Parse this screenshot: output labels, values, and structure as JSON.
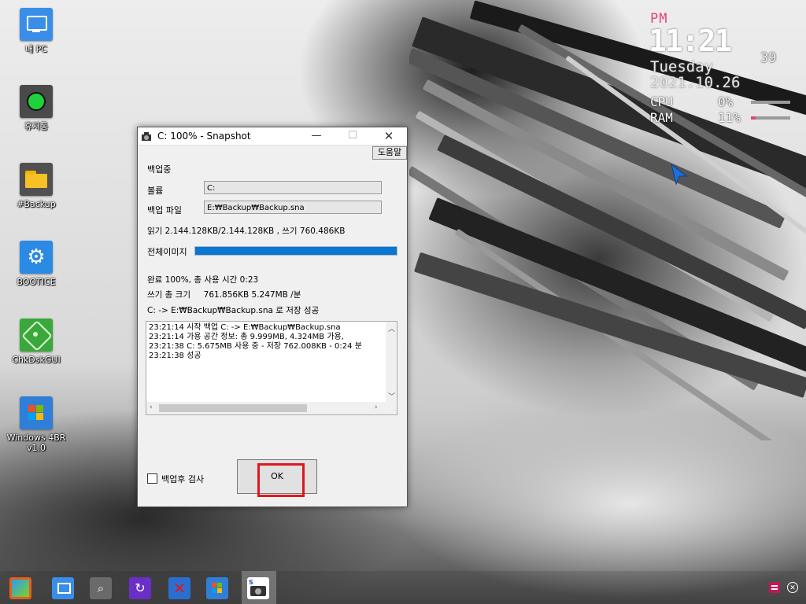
{
  "desktop": {
    "icons": [
      {
        "label": "내 PC",
        "icon": "monitor-icon"
      },
      {
        "label": "휴지통",
        "icon": "recycle-bin-icon"
      },
      {
        "label": "#Backup",
        "icon": "folder-icon"
      },
      {
        "label": "BOOTICE",
        "icon": "gear-icon"
      },
      {
        "label": "ChkDskGUI",
        "icon": "disk-check-icon"
      },
      {
        "label": "Windows 4BR v1.0",
        "icon": "windows-logo-icon"
      }
    ]
  },
  "clock_widget": {
    "ampm": "PM",
    "time": "11:21",
    "seconds": "39",
    "day": "Tuesday",
    "date": "2021.10.26",
    "cpu_label": "CPU",
    "cpu_value": "0%",
    "cpu_fraction": 0.0,
    "ram_label": "RAM",
    "ram_value": "11%",
    "ram_fraction": 0.11,
    "accent_color": "#e4407f"
  },
  "dialog": {
    "title": "C: 100% - Snapshot",
    "help_label": "도움말",
    "status_heading": "백업중",
    "volume_label": "볼륨",
    "volume_value": "C:",
    "backup_file_label": "백업 파일",
    "backup_file_value": "E:₩Backup₩Backup.sna",
    "read_write_info": "읽기 2.144.128KB/2.144.128KB , 쓰기    760.486KB",
    "overall_image_label": "전체이미지",
    "overall_progress": 1.0,
    "complete_info": "완료 100%, 총 사용 시간  0:23",
    "write_total_info": "쓰기 총 크기     761.856KB 5.247MB /분",
    "save_result": "C: -> E:₩Backup₩Backup.sna 로 저장 성공",
    "log_lines": [
      "23:21:14 시작  백업 C: -> E:₩Backup₩Backup.sna",
      "23:21:14 가용 공간 정보: 총    9.999MB,    4.324MB 가용,",
      "23:21:38 C:     5.675MB 사용 중 - 저장  762.008KB - 0:24 분",
      "23:21:38 성공"
    ],
    "verify_checkbox_label": "백업후 검사",
    "verify_checked": false,
    "ok_label": "OK",
    "progress_color": "#0a76d3",
    "highlight_color": "#e0161f"
  },
  "taskbar": {
    "items": [
      "start-icon",
      "my-pc-icon",
      "search-icon",
      "restart-icon",
      "close-x-icon",
      "windows-4br-icon",
      "snapshot-icon"
    ],
    "active_item": "snapshot-icon",
    "tray": [
      "tray-app-icon",
      "tray-close-icon"
    ]
  }
}
